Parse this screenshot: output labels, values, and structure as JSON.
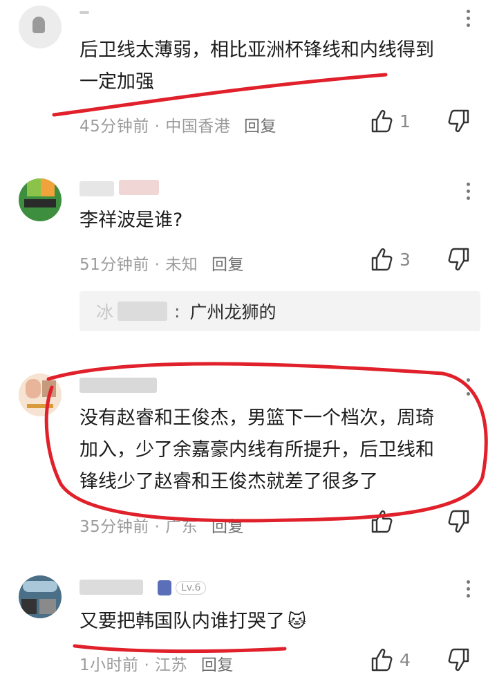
{
  "comments": [
    {
      "username": "",
      "text_lines": [
        "后卫线太薄弱，相比亚洲杯锋线和内线得到",
        "一定加强"
      ],
      "time": "45分钟前",
      "location": "中国香港",
      "reply_label": "回复",
      "likes": "1"
    },
    {
      "username": "",
      "text_lines": [
        "李祥波是谁?"
      ],
      "time": "51分钟前",
      "location": "未知",
      "reply_label": "回复",
      "likes": "3",
      "sub_reply": {
        "author": "冰",
        "separator": ":",
        "text": "广州龙狮的"
      }
    },
    {
      "username": "",
      "text_lines": [
        "没有赵睿和王俊杰，男篮下一个档次，周琦",
        "加入，少了余嘉豪内线有所提升，后卫线和",
        "锋线少了赵睿和王俊杰就差了很多了"
      ],
      "time": "35分钟前",
      "location": "广东",
      "reply_label": "回复",
      "likes": ""
    },
    {
      "username": "",
      "level": "Lv.6",
      "text_lines": [
        "又要把韩国队内谁打哭了"
      ],
      "emoji": "🐱",
      "time": "1小时前",
      "location": "江苏",
      "reply_label": "回复",
      "likes": "4"
    }
  ],
  "meta_separator": "·",
  "colors": {
    "annotation": "#e0202a",
    "meta": "#9b9b9b",
    "text": "#1c1c1c"
  },
  "icons": [
    "more-icon",
    "thumbs-up-icon",
    "thumbs-down-icon"
  ]
}
